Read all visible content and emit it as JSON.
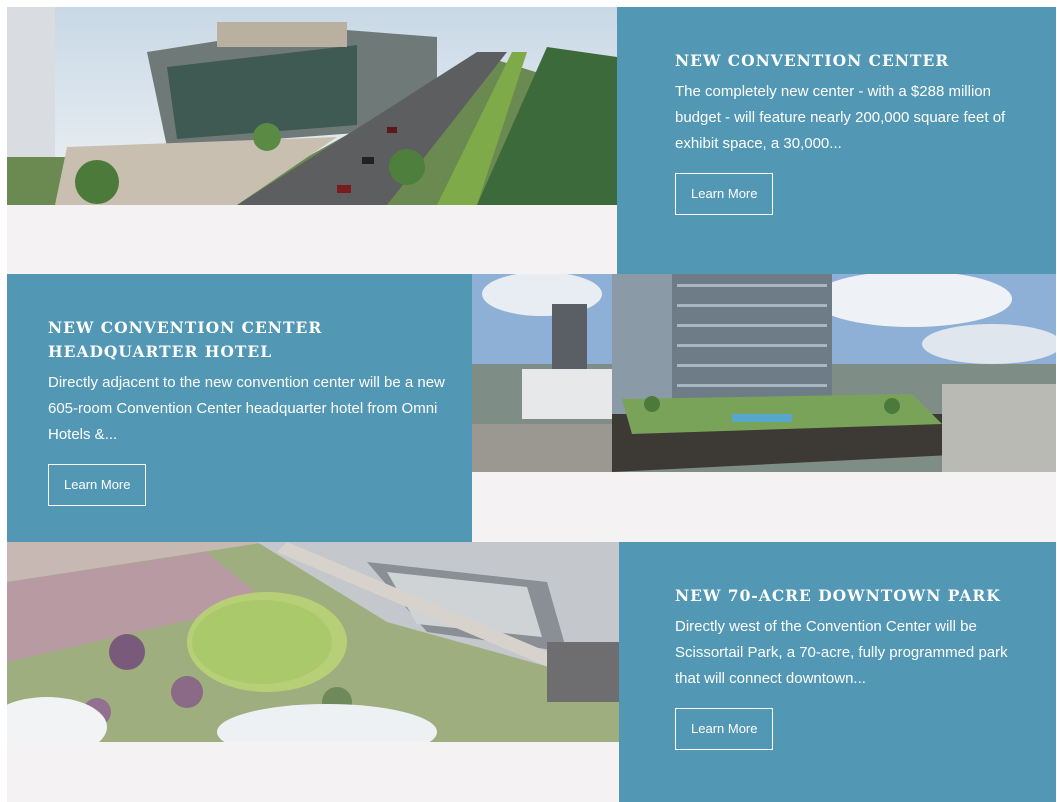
{
  "sections": [
    {
      "title": "NEW CONVENTION CENTER",
      "description": "The completely new center - with a $288 million budget - will feature nearly 200,000 square feet of exhibit space, a 30,000...",
      "button": "Learn More",
      "image": "convention-center-rendering"
    },
    {
      "title_line1": "NEW CONVENTION CENTER",
      "title_line2": "HEADQUARTER HOTEL",
      "description": "Directly adjacent to the new convention center will be a new 605-room Convention Center headquarter hotel from Omni Hotels &...",
      "button": "Learn More",
      "image": "headquarter-hotel-rendering"
    },
    {
      "title": "NEW 70-ACRE DOWNTOWN PARK",
      "description": "Directly west of the Convention Center will be Scissortail Park, a 70-acre, fully programmed park that will connect downtown...",
      "button": "Learn More",
      "image": "downtown-park-aerial-rendering"
    }
  ],
  "colors": {
    "panel": "#5298b5",
    "under_image": "#f4f2f2"
  }
}
